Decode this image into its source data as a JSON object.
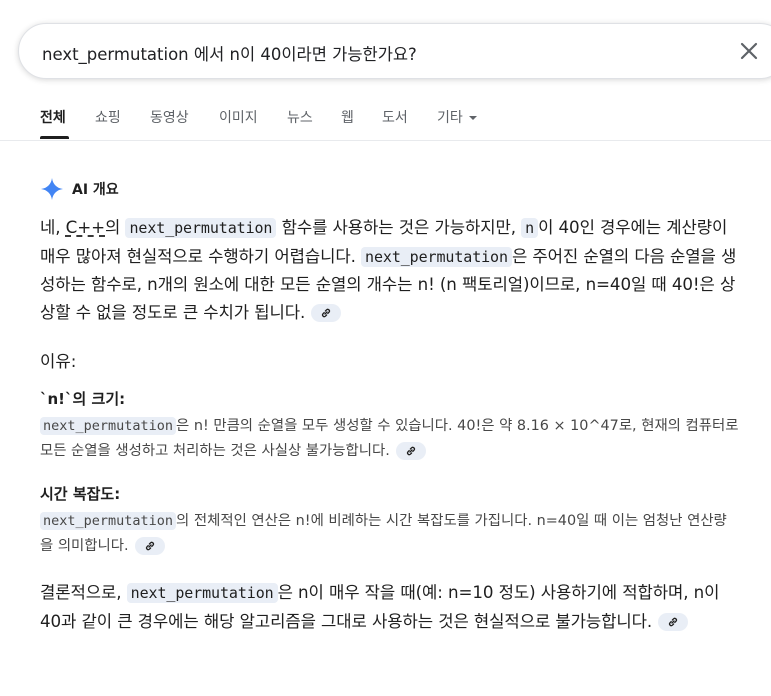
{
  "search": {
    "query": "next_permutation 에서 n이 40이라면 가능한가요?"
  },
  "tabs": [
    {
      "label": "전체"
    },
    {
      "label": "쇼핑"
    },
    {
      "label": "동영상"
    },
    {
      "label": "이미지"
    },
    {
      "label": "뉴스"
    },
    {
      "label": "웹"
    },
    {
      "label": "도서"
    },
    {
      "label": "기타"
    }
  ],
  "ai_overview": {
    "title": "AI 개요",
    "intro": {
      "t1": "네, ",
      "cpp": "C++",
      "t2": "의 ",
      "code": "next_permutation",
      "t3": " 함수를 사용하는 것은 가능하지만, ",
      "n": "n",
      "t4": "이 40인 경우에는 계산량이 매우 많아져 현실적으로 수행하기 어렵습니다. ",
      "code2": "next_permutation",
      "t5": "은 주어진 순열의 다음 순열을 생성하는 함수로, n개의 원소에 대한 모든 순열의 개수는 n! (n 팩토리얼)이므로, n=40일 때 40!은 상상할 수 없을 정도로 큰 수치가 됩니다."
    },
    "reason_title": "이유:",
    "reasons": [
      {
        "heading": "`n!`의 크기:",
        "code": "next_permutation",
        "text": "은 n! 만큼의 순열을 모두 생성할 수 있습니다. 40!은 약 8.16 × 10^47로, 현재의 컴퓨터로 모든 순열을 생성하고 처리하는 것은 사실상 불가능합니다."
      },
      {
        "heading": "시간 복잡도:",
        "code": "next_permutation",
        "text": "의 전체적인 연산은 n!에 비례하는 시간 복잡도를 가집니다. n=40일 때 이는 엄청난 연산량을 의미합니다."
      }
    ],
    "conclusion": {
      "t1": "결론적으로, ",
      "code": "next_permutation",
      "t2": "은 n이 매우 작을 때(예: n=10 정도) 사용하기에 적합하며, n이 40과 같이 큰 경우에는 해당 알고리즘을 그대로 사용하는 것은 현실적으로 불가능합니다."
    }
  },
  "colors": {
    "accent_blue": "#4285f4",
    "chip_bg": "#e9eef6"
  }
}
